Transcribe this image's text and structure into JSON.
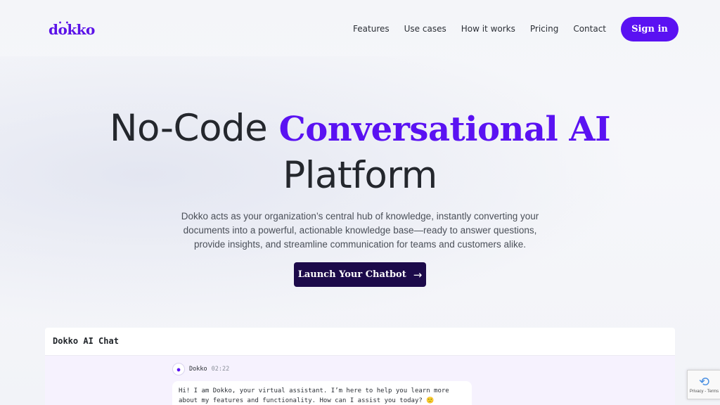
{
  "brand": {
    "name": "dokko",
    "color": "#5a12f2"
  },
  "nav": {
    "items": [
      "Features",
      "Use cases",
      "How it works",
      "Pricing",
      "Contact"
    ],
    "signin_label": "Sign in"
  },
  "hero": {
    "title_pre": "No-Code ",
    "title_accent": "Conversational AI",
    "title_post": "Platform",
    "description": "Dokko acts as your organization’s central hub of knowledge, instantly converting your documents into a powerful, actionable knowledge base—ready to answer questions, provide insights, and streamline communication for teams and customers alike.",
    "cta_label": "Launch Your Chatbot",
    "cta_icon": "arrow-right-icon"
  },
  "chat": {
    "title": "Dokko AI Chat",
    "message": {
      "sender": "Dokko",
      "time": "02:22",
      "text": "Hi! I am Dokko, your virtual assistant. I’m here to help you learn more about my features and functionality. How can I assist you today? 🙂"
    }
  },
  "recaptcha": {
    "legal": "Privacy - Terms"
  }
}
